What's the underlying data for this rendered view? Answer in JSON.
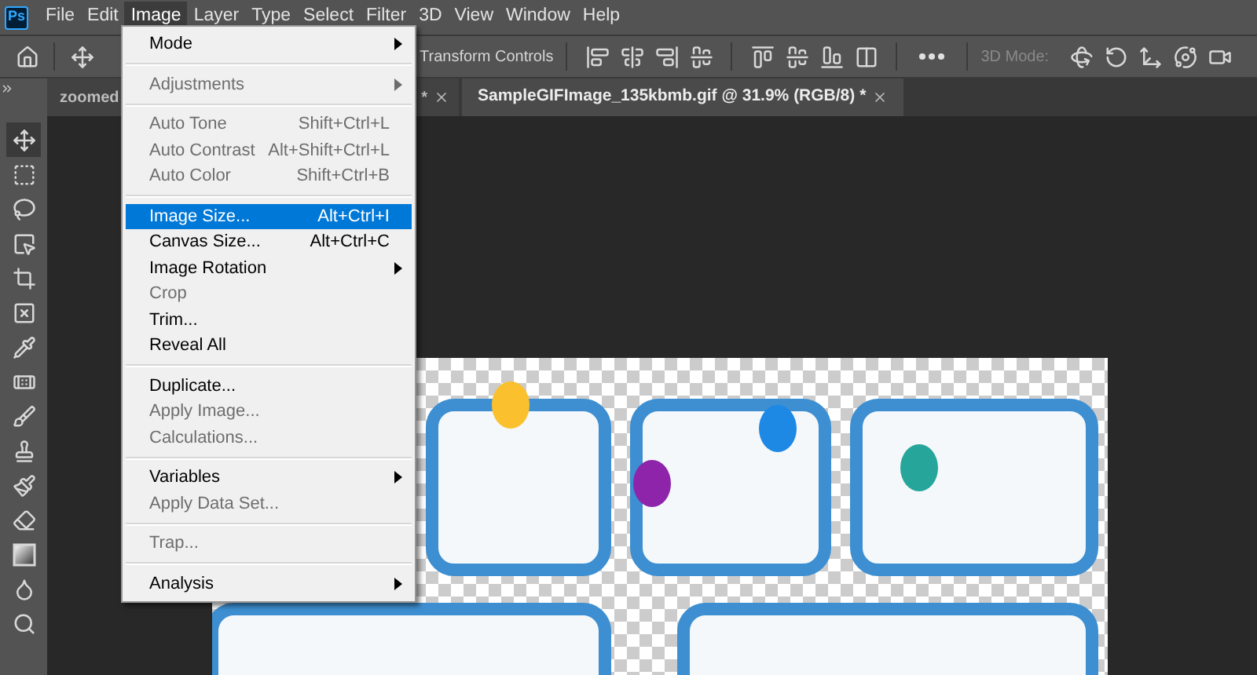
{
  "logo": "Ps",
  "menu_bar": [
    {
      "label": "File",
      "selected": false
    },
    {
      "label": "Edit",
      "selected": false
    },
    {
      "label": "Image",
      "selected": true
    },
    {
      "label": "Layer",
      "selected": false
    },
    {
      "label": "Type",
      "selected": false
    },
    {
      "label": "Select",
      "selected": false
    },
    {
      "label": "Filter",
      "selected": false
    },
    {
      "label": "3D",
      "selected": false
    },
    {
      "label": "View",
      "selected": false
    },
    {
      "label": "Window",
      "selected": false
    },
    {
      "label": "Help",
      "selected": false
    }
  ],
  "options_bar": {
    "transform_label": "Transform Controls",
    "mode_label": "3D Mode:"
  },
  "tabs": [
    {
      "label": "zoomed",
      "suffix": "*",
      "selected": false
    },
    {
      "label": "SampleGIFImage_135kbmb.gif @ 31.9% (RGB/8) *",
      "selected": true
    }
  ],
  "image_menu": [
    {
      "kind": "item",
      "label": "Mode",
      "submenu": true,
      "disabled": false,
      "selected": false
    },
    {
      "kind": "separator"
    },
    {
      "kind": "item",
      "label": "Adjustments",
      "submenu": true,
      "disabled": true,
      "selected": false
    },
    {
      "kind": "separator"
    },
    {
      "kind": "item",
      "label": "Auto Tone",
      "shortcut": "Shift+Ctrl+L",
      "disabled": true,
      "selected": false
    },
    {
      "kind": "item",
      "label": "Auto Contrast",
      "shortcut": "Alt+Shift+Ctrl+L",
      "disabled": true,
      "selected": false
    },
    {
      "kind": "item",
      "label": "Auto Color",
      "shortcut": "Shift+Ctrl+B",
      "disabled": true,
      "selected": false
    },
    {
      "kind": "separator"
    },
    {
      "kind": "item",
      "label": "Image Size...",
      "shortcut": "Alt+Ctrl+I",
      "disabled": false,
      "selected": true
    },
    {
      "kind": "item",
      "label": "Canvas Size...",
      "shortcut": "Alt+Ctrl+C",
      "disabled": false,
      "selected": false
    },
    {
      "kind": "item",
      "label": "Image Rotation",
      "submenu": true,
      "disabled": false,
      "selected": false
    },
    {
      "kind": "item",
      "label": "Crop",
      "disabled": true,
      "selected": false
    },
    {
      "kind": "item",
      "label": "Trim...",
      "disabled": false,
      "selected": false
    },
    {
      "kind": "item",
      "label": "Reveal All",
      "disabled": false,
      "selected": false
    },
    {
      "kind": "separator"
    },
    {
      "kind": "item",
      "label": "Duplicate...",
      "disabled": false,
      "selected": false
    },
    {
      "kind": "item",
      "label": "Apply Image...",
      "disabled": true,
      "selected": false
    },
    {
      "kind": "item",
      "label": "Calculations...",
      "disabled": true,
      "selected": false
    },
    {
      "kind": "separator"
    },
    {
      "kind": "item",
      "label": "Variables",
      "submenu": true,
      "disabled": false,
      "selected": false
    },
    {
      "kind": "item",
      "label": "Apply Data Set...",
      "disabled": true,
      "selected": false
    },
    {
      "kind": "separator"
    },
    {
      "kind": "item",
      "label": "Trap...",
      "disabled": true,
      "selected": false
    },
    {
      "kind": "separator"
    },
    {
      "kind": "item",
      "label": "Analysis",
      "submenu": true,
      "disabled": false,
      "selected": false
    }
  ]
}
